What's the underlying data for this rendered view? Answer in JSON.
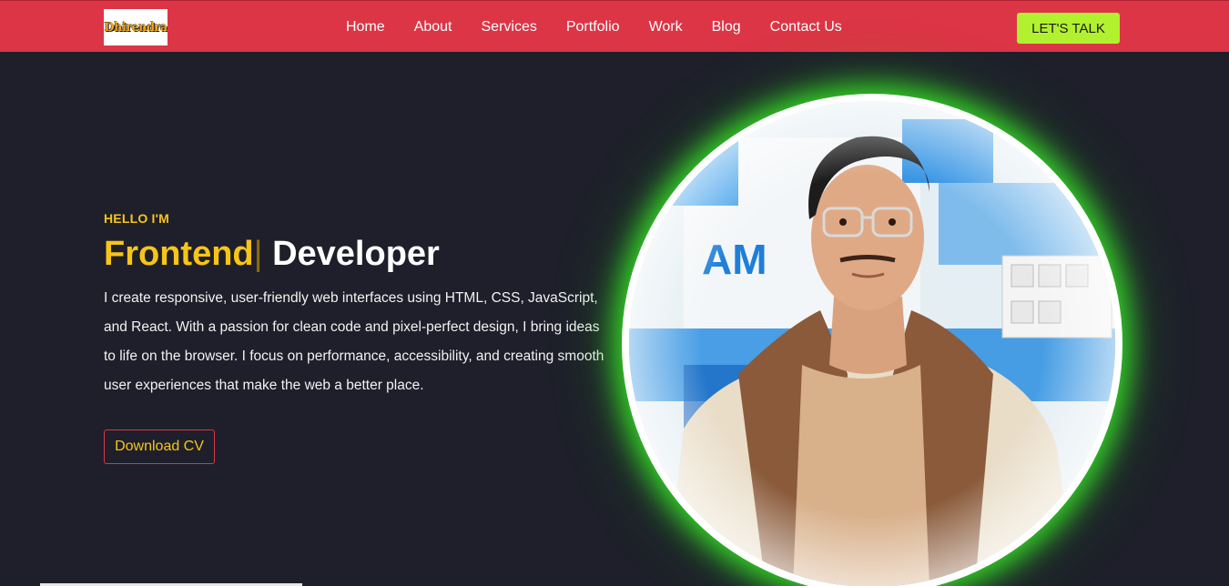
{
  "navbar": {
    "logo_text": "Dhirendra",
    "links": [
      "Home",
      "About",
      "Services",
      "Portfolio",
      "Work",
      "Blog",
      "Contact Us"
    ],
    "cta_label": "LET'S TALK"
  },
  "hero": {
    "greeting": "HELLO I'M",
    "role": "Frontend",
    "cursor": "|",
    "title": "Developer",
    "bio": "I create responsive, user-friendly web interfaces using HTML, CSS, JavaScript, and React. With a passion for clean code and pixel-perfect design, I bring ideas to life on the browser. I focus on performance, accessibility, and creating smooth user experiences that make the web a better place.",
    "cv_label": "Download CV",
    "photo_sign_text": "AM"
  },
  "colors": {
    "navbar": "#dc3545",
    "background": "#1e1f2a",
    "accent_yellow": "#f7c517",
    "cta_green": "#b2f12f",
    "glow_green": "#3cff28"
  }
}
